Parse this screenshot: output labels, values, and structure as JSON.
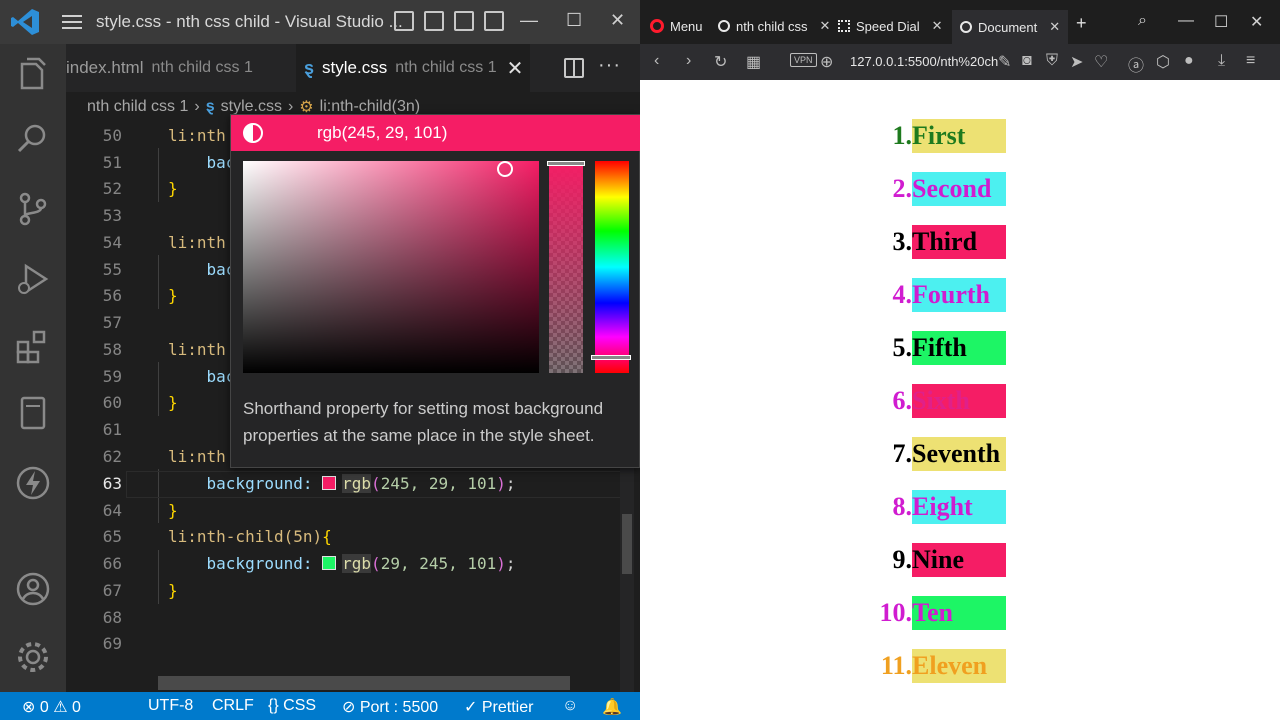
{
  "vscode": {
    "window_title": "style.css - nth css child - Visual Studio ...",
    "tabs": [
      {
        "name": "index.html",
        "folder": "nth child css 1"
      },
      {
        "name": "style.css",
        "folder": "nth child css 1"
      }
    ],
    "breadcrumb": [
      "nth child css 1",
      "style.css",
      "li:nth-child(3n)"
    ],
    "code_lines": [
      {
        "n": "50",
        "text": "li:nth"
      },
      {
        "n": "51",
        "text": "    bac"
      },
      {
        "n": "52",
        "text": "}"
      },
      {
        "n": "53",
        "text": ""
      },
      {
        "n": "54",
        "text": "li:nth"
      },
      {
        "n": "55",
        "text": "    bac"
      },
      {
        "n": "56",
        "text": "}"
      },
      {
        "n": "57",
        "text": ""
      },
      {
        "n": "58",
        "text": "li:nth"
      },
      {
        "n": "59",
        "text": "    bac"
      },
      {
        "n": "60",
        "text": "}"
      },
      {
        "n": "61",
        "text": ""
      },
      {
        "n": "62",
        "text": "li:nth"
      },
      {
        "n": "63",
        "text": "    background: rgb(245, 29, 101);"
      },
      {
        "n": "64",
        "text": "}"
      },
      {
        "n": "65",
        "text": "li:nth-child(5n){"
      },
      {
        "n": "66",
        "text": "    background: rgb(29, 245, 101);"
      },
      {
        "n": "67",
        "text": "}"
      },
      {
        "n": "68",
        "text": ""
      },
      {
        "n": "69",
        "text": ""
      }
    ],
    "active_line": "63",
    "line63": {
      "prop": "background:",
      "fn": "rgb",
      "args": "245, 29, 101",
      "swatch": "#f51d65"
    },
    "line65": {
      "selector": "li:nth-child(5n)",
      "brace": "{"
    },
    "line66": {
      "prop": "background:",
      "fn": "rgb",
      "args": "29, 245, 101",
      "swatch": "#1df565"
    },
    "color_picker": {
      "value": "rgb(245, 29, 101)",
      "color": "#f51d65",
      "description": "Shorthand property for setting most background properties at the same place in the style sheet."
    },
    "status": {
      "errors": "0",
      "warnings": "0",
      "encoding": "UTF-8",
      "eol": "CRLF",
      "language": "CSS",
      "port": "Port : 5500",
      "formatter": "Prettier"
    }
  },
  "browser": {
    "tabs": [
      {
        "label": "Menu",
        "icon": "opera-icon"
      },
      {
        "label": "nth child css",
        "icon": "globe-icon"
      },
      {
        "label": "Speed Dial",
        "icon": "grid-icon"
      },
      {
        "label": "Document",
        "icon": "globe-icon"
      }
    ],
    "url": "127.0.0.1:5500/nth%20ch",
    "vpn": "VPN",
    "list": [
      {
        "marker": "1.",
        "text": "First",
        "bg": "#ede173",
        "marker_color": "#1e7a1e",
        "text_color": "#1e7a1e"
      },
      {
        "marker": "2.",
        "text": "Second",
        "bg": "#4cf0f0",
        "marker_color": "#d01cd0",
        "text_color": "#d01cd0"
      },
      {
        "marker": "3.",
        "text": "Third",
        "bg": "#f51d65",
        "marker_color": "#000000",
        "text_color": "#000000"
      },
      {
        "marker": "4.",
        "text": "Fourth",
        "bg": "#4cf0f0",
        "marker_color": "#d01cd0",
        "text_color": "#d01cd0"
      },
      {
        "marker": "5.",
        "text": "Fifth",
        "bg": "#1df565",
        "marker_color": "#000000",
        "text_color": "#000000"
      },
      {
        "marker": "6.",
        "text": "Sixth",
        "bg": "#f51d65",
        "marker_color": "#d01cd0",
        "text_color": "#e0208a"
      },
      {
        "marker": "7.",
        "text": "Seventh",
        "bg": "#ede173",
        "marker_color": "#000000",
        "text_color": "#000000"
      },
      {
        "marker": "8.",
        "text": "Eight",
        "bg": "#4cf0f0",
        "marker_color": "#d01cd0",
        "text_color": "#d01cd0"
      },
      {
        "marker": "9.",
        "text": "Nine",
        "bg": "#f51d65",
        "marker_color": "#000000",
        "text_color": "#000000"
      },
      {
        "marker": "10.",
        "text": "Ten",
        "bg": "#1df565",
        "marker_color": "#d01cd0",
        "text_color": "#d01cd0"
      },
      {
        "marker": "11.",
        "text": "Eleven",
        "bg": "#ede173",
        "marker_color": "#f0a020",
        "text_color": "#f0a020"
      }
    ]
  }
}
